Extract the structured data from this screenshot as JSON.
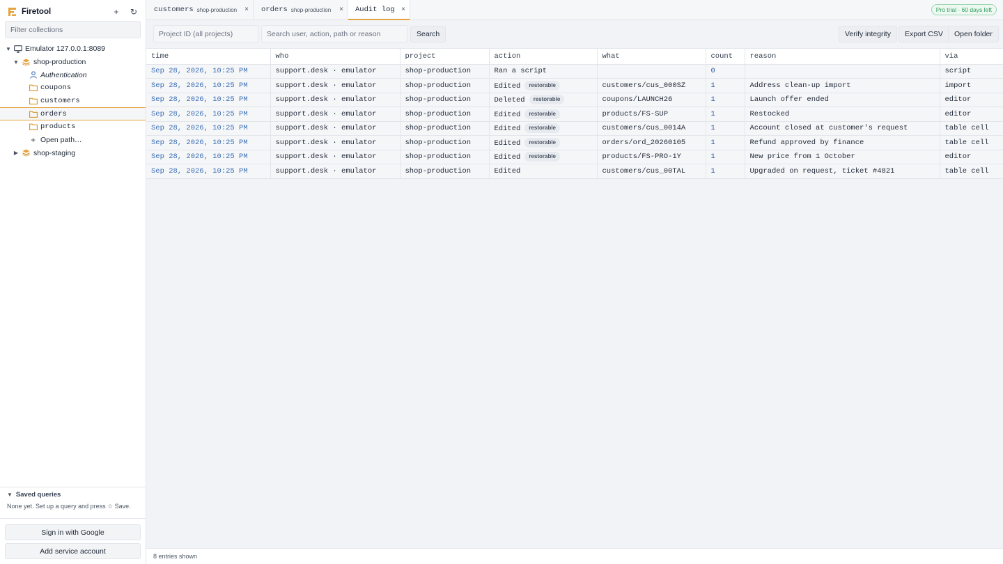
{
  "app": {
    "name": "Firetool"
  },
  "sidebar": {
    "filter_placeholder": "Filter collections",
    "tree": {
      "emulator": "Emulator 127.0.0.1:8089",
      "project": "shop-production",
      "auth": "Authentication",
      "collections": [
        "coupons",
        "customers",
        "orders",
        "products"
      ],
      "selected": "orders",
      "open_path": "Open path…",
      "other_project": "shop-staging"
    },
    "saved_queries": {
      "title": "Saved queries",
      "empty": "None yet. Set up a query and press ☆ Save."
    },
    "sign_in_label": "Sign in with Google",
    "service_account_label": "Add service account"
  },
  "tabs": [
    {
      "name": "customers",
      "sub": "shop-production",
      "close": "×"
    },
    {
      "name": "orders",
      "sub": "shop-production",
      "close": "×"
    },
    {
      "name": "Audit log",
      "sub": "",
      "close": "×",
      "active": true
    }
  ],
  "trial_badge": "Pro trial · 60 days left",
  "toolbar": {
    "project_placeholder": "Project ID (all projects)",
    "search_placeholder": "Search user, action, path or reason",
    "search_label": "Search",
    "verify_label": "Verify integrity",
    "export_label": "Export CSV",
    "open_folder_label": "Open folder"
  },
  "table": {
    "columns": [
      "time",
      "who",
      "project",
      "action",
      "what",
      "count",
      "reason",
      "via"
    ],
    "badge_label": "restorable",
    "rows": [
      {
        "time": "Sep 28, 2026, 10:25 PM",
        "who": "support.desk · emulator",
        "project": "shop-production",
        "action": "Ran a script",
        "restorable": false,
        "what": "",
        "count": "0",
        "reason": "",
        "via": "script"
      },
      {
        "time": "Sep 28, 2026, 10:25 PM",
        "who": "support.desk · emulator",
        "project": "shop-production",
        "action": "Edited",
        "restorable": true,
        "what": "customers/cus_000SZ",
        "count": "1",
        "reason": "Address clean-up import",
        "via": "import"
      },
      {
        "time": "Sep 28, 2026, 10:25 PM",
        "who": "support.desk · emulator",
        "project": "shop-production",
        "action": "Deleted",
        "restorable": true,
        "what": "coupons/LAUNCH26",
        "count": "1",
        "reason": "Launch offer ended",
        "via": "editor"
      },
      {
        "time": "Sep 28, 2026, 10:25 PM",
        "who": "support.desk · emulator",
        "project": "shop-production",
        "action": "Edited",
        "restorable": true,
        "what": "products/FS-SUP",
        "count": "1",
        "reason": "Restocked",
        "via": "editor"
      },
      {
        "time": "Sep 28, 2026, 10:25 PM",
        "who": "support.desk · emulator",
        "project": "shop-production",
        "action": "Edited",
        "restorable": true,
        "what": "customers/cus_0014A",
        "count": "1",
        "reason": "Account closed at customer's request",
        "via": "table cell"
      },
      {
        "time": "Sep 28, 2026, 10:25 PM",
        "who": "support.desk · emulator",
        "project": "shop-production",
        "action": "Edited",
        "restorable": true,
        "what": "orders/ord_20260105",
        "count": "1",
        "reason": "Refund approved by finance",
        "via": "table cell"
      },
      {
        "time": "Sep 28, 2026, 10:25 PM",
        "who": "support.desk · emulator",
        "project": "shop-production",
        "action": "Edited",
        "restorable": true,
        "what": "products/FS-PRO-1Y",
        "count": "1",
        "reason": "New price from 1 October",
        "via": "editor"
      },
      {
        "time": "Sep 28, 2026, 10:25 PM",
        "who": "support.desk · emulator",
        "project": "shop-production",
        "action": "Edited",
        "restorable": false,
        "what": "customers/cus_00TAL",
        "count": "1",
        "reason": "Upgraded on request, ticket #4821",
        "via": "table cell"
      }
    ]
  },
  "status": "8 entries shown",
  "colors": {
    "accent": "#e6a23c",
    "link": "#3b6fb5",
    "trial": "#2f9e5c"
  }
}
